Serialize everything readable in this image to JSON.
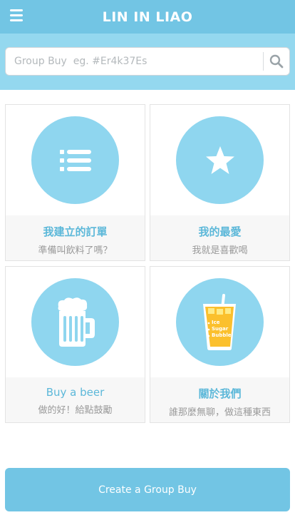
{
  "header": {
    "title": "LIN IN LIAO"
  },
  "search": {
    "placeholder": "Group Buy  eg. #Er4k37Es",
    "value": ""
  },
  "cards": [
    {
      "title": "我建立的訂單",
      "subtitle": "準備叫飲料了嗎？",
      "icon": "list-icon"
    },
    {
      "title": "我的最愛",
      "subtitle": "我就是喜歡喝",
      "icon": "star-icon"
    },
    {
      "title": "Buy a beer",
      "subtitle": "做的好！給點鼓勵",
      "icon": "beer-mug-icon"
    },
    {
      "title": "關於我們",
      "subtitle": "誰那麼無聊，做這種東西",
      "icon": "bubble-tea-icon",
      "icon_text": [
        "Ice",
        "Sugar",
        "Bubble"
      ]
    }
  ],
  "create_button": {
    "label": "Create a Group Buy"
  },
  "colors": {
    "header": "#72c5e4",
    "search_band": "#94d8ef",
    "circle": "#8fd6ef",
    "accent_text": "#5cb8d9"
  }
}
